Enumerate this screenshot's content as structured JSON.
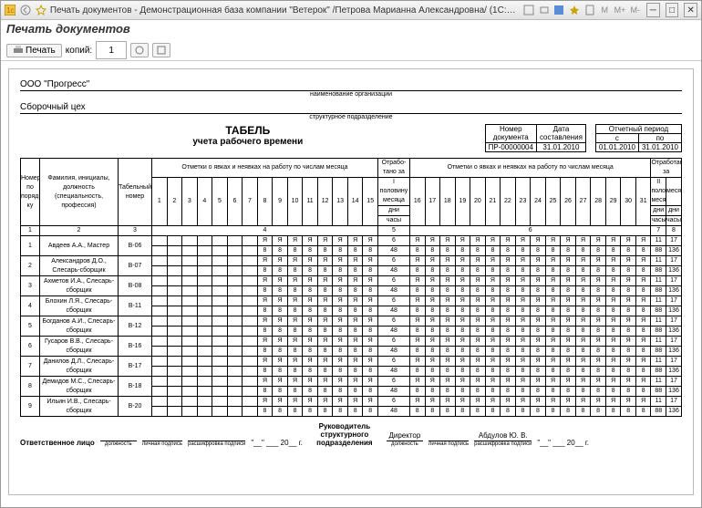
{
  "window": {
    "title": "Печать документов - Демонстрационная база компании \"Ветерок\" /Петрова Марианна Александровна/ (1С:Предприятие)"
  },
  "tab": {
    "title": "Печать документов"
  },
  "toolbar": {
    "print": "Печать",
    "copies_label": "копий:",
    "copies": "1"
  },
  "org": {
    "name": "ООО \"Прогресс\"",
    "sub": "наименование организации"
  },
  "dept": {
    "name": "Сборочный цех",
    "sub": "структурное подразделение"
  },
  "doc_title": {
    "l1": "ТАБЕЛЬ",
    "l2": "учета рабочего времени"
  },
  "doc_num": {
    "h1": "Номер",
    "h2": "документа",
    "v": "ПР-00000004"
  },
  "doc_date": {
    "h1": "Дата",
    "h2": "составления",
    "v": "31.01.2010"
  },
  "period": {
    "h": "Отчетный период",
    "c1": "с",
    "c2": "по",
    "v1": "01.01.2010",
    "v2": "31.01.2010"
  },
  "thead": {
    "no": "Номер по поряд-ку",
    "fio": "Фамилия, инициалы, должность (специальность, профессия)",
    "tabn": "Табельный номер",
    "marks": "Отметки о явках и неявках на работу по числам месяца",
    "half1": "Отрабо-тано за",
    "half1a": "I половину месяца",
    "half2": "Отработано за",
    "half2a": "II половину месяца",
    "month": "месяц",
    "days": "дни",
    "hours": "часы"
  },
  "hrow": {
    "c1": "1",
    "c2": "2",
    "c3": "3",
    "c4": "4",
    "c5": "5",
    "c6": "6",
    "c7": "7",
    "c8": "8"
  },
  "rows": [
    {
      "no": "1",
      "fio": "Авдеев А.А., Мастер",
      "tabn": "В-06",
      "d1": 6,
      "h1": 48,
      "d2": 11,
      "h2": 88,
      "dm": 17,
      "hm": 136
    },
    {
      "no": "2",
      "fio": "Александров Д.О., Слесарь-сборщик",
      "tabn": "В-07",
      "d1": 6,
      "h1": 48,
      "d2": 11,
      "h2": 88,
      "dm": 17,
      "hm": 136
    },
    {
      "no": "3",
      "fio": "Ахметов И.А., Слесарь-сборщик",
      "tabn": "В-08",
      "d1": 6,
      "h1": 48,
      "d2": 11,
      "h2": 88,
      "dm": 17,
      "hm": 136
    },
    {
      "no": "4",
      "fio": "Блохин Л.Я., Слесарь-сборщик",
      "tabn": "В-11",
      "d1": 6,
      "h1": 48,
      "d2": 11,
      "h2": 88,
      "dm": 17,
      "hm": 136
    },
    {
      "no": "5",
      "fio": "Богданов А.И., Слесарь-сборщик",
      "tabn": "В-12",
      "d1": 6,
      "h1": 48,
      "d2": 11,
      "h2": 88,
      "dm": 17,
      "hm": 136
    },
    {
      "no": "6",
      "fio": "Гусаров В.В., Слесарь-сборщик",
      "tabn": "В-16",
      "d1": 6,
      "h1": 48,
      "d2": 11,
      "h2": 88,
      "dm": 17,
      "hm": 136
    },
    {
      "no": "7",
      "fio": "Данилов Д.Л., Слесарь-сборщик",
      "tabn": "В-17",
      "d1": 6,
      "h1": 48,
      "d2": 11,
      "h2": 88,
      "dm": 17,
      "hm": 136
    },
    {
      "no": "8",
      "fio": "Демидов М.С., Слесарь-сборщик",
      "tabn": "В-18",
      "d1": 6,
      "h1": 48,
      "d2": 11,
      "h2": 88,
      "dm": 17,
      "hm": 136
    },
    {
      "no": "9",
      "fio": "Ильин И.В., Слесарь-сборщик",
      "tabn": "В-20",
      "d1": 6,
      "h1": 48,
      "d2": 11,
      "h2": 88,
      "dm": 17,
      "hm": 136
    }
  ],
  "marks": {
    "present": "Я",
    "hours": "8"
  },
  "sig": {
    "responsible": "Ответственное лицо",
    "position": "должность",
    "sign": "личная подпись",
    "decode": "расшифровка подписи",
    "head": "Руководитель структурного подразделения",
    "head_pos": "Директор",
    "head_name": "Абдулов Ю. В.",
    "date_tpl": "\"__\" ___ 20__ г."
  },
  "chart_data": {
    "type": "table",
    "title": "ТАБЕЛЬ учета рабочего времени",
    "organization": "ООО \"Прогресс\"",
    "department": "Сборочный цех",
    "document_number": "ПР-00000004",
    "document_date": "31.01.2010",
    "period": {
      "from": "01.01.2010",
      "to": "31.01.2010"
    },
    "columns": [
      "№",
      "ФИО, должность",
      "Таб. номер",
      "Дни (I пол.)",
      "Часы (I пол.)",
      "Дни (II пол.)",
      "Часы (II пол.)",
      "Дни (месяц)",
      "Часы (месяц)"
    ],
    "data": [
      [
        1,
        "Авдеев А.А., Мастер",
        "В-06",
        6,
        48,
        11,
        88,
        17,
        136
      ],
      [
        2,
        "Александров Д.О., Слесарь-сборщик",
        "В-07",
        6,
        48,
        11,
        88,
        17,
        136
      ],
      [
        3,
        "Ахметов И.А., Слесарь-сборщик",
        "В-08",
        6,
        48,
        11,
        88,
        17,
        136
      ],
      [
        4,
        "Блохин Л.Я., Слесарь-сборщик",
        "В-11",
        6,
        48,
        11,
        88,
        17,
        136
      ],
      [
        5,
        "Богданов А.И., Слесарь-сборщик",
        "В-12",
        6,
        48,
        11,
        88,
        17,
        136
      ],
      [
        6,
        "Гусаров В.В., Слесарь-сборщик",
        "В-16",
        6,
        48,
        11,
        88,
        17,
        136
      ],
      [
        7,
        "Данилов Д.Л., Слесарь-сборщик",
        "В-17",
        6,
        48,
        11,
        88,
        17,
        136
      ],
      [
        8,
        "Демидов М.С., Слесарь-сборщик",
        "В-18",
        6,
        48,
        11,
        88,
        17,
        136
      ],
      [
        9,
        "Ильин И.В., Слесарь-сборщик",
        "В-20",
        6,
        48,
        11,
        88,
        17,
        136
      ]
    ]
  }
}
